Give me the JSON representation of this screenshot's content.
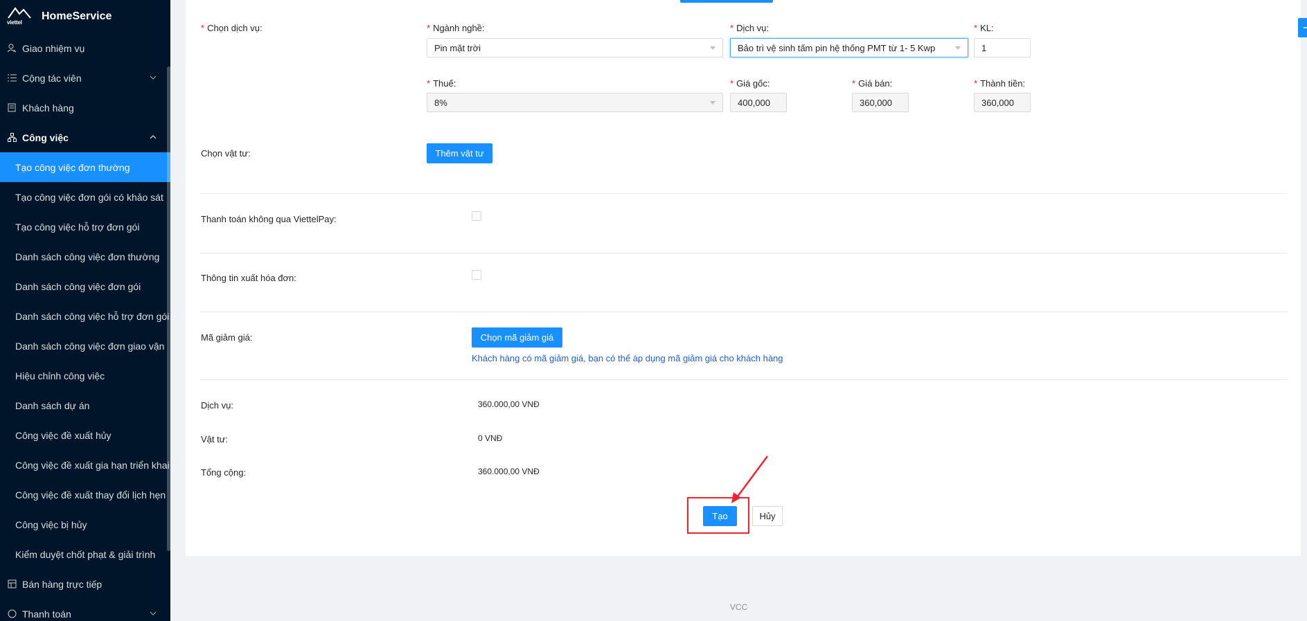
{
  "app": {
    "title": "HomeService",
    "logo_text": "viettel"
  },
  "sidebar": {
    "items": [
      {
        "label": "Giao nhiệm vụ"
      },
      {
        "label": "Cộng tác viên"
      },
      {
        "label": "Khách hàng"
      },
      {
        "label": "Công việc"
      }
    ],
    "sub_items": [
      {
        "label": "Tạo công việc đơn thường"
      },
      {
        "label": "Tạo công việc đơn gói có khảo sát"
      },
      {
        "label": "Tạo công việc hỗ trợ đơn gói"
      },
      {
        "label": "Danh sách công việc đơn thường"
      },
      {
        "label": "Danh sách công việc đơn gói"
      },
      {
        "label": "Danh sách công việc hỗ trợ đơn gói"
      },
      {
        "label": "Danh sách công việc đơn giao vận"
      },
      {
        "label": "Hiệu chỉnh công việc"
      },
      {
        "label": "Danh sách dự án"
      },
      {
        "label": "Công việc đề xuất hủy"
      },
      {
        "label": "Công việc đề xuất gia hạn triển khai"
      },
      {
        "label": "Công việc đề xuất thay đổi lịch hẹn"
      },
      {
        "label": "Công việc bị hủy"
      },
      {
        "label": "Kiểm duyệt chốt phạt & giải trình"
      }
    ],
    "bottom_items": [
      {
        "label": "Bán hàng trực tiếp"
      },
      {
        "label": "Thanh toán"
      }
    ]
  },
  "form": {
    "service_section_label": "Chọn dịch vụ:",
    "nganh_nghe": {
      "label": "Ngành nghề:",
      "value": "Pin mặt trời"
    },
    "dich_vu": {
      "label": "Dịch vụ:",
      "value": "Bảo trì vệ sinh tấm pin hệ thống PMT từ 1- 5 Kwp"
    },
    "kl": {
      "label": "KL:",
      "value": "1"
    },
    "thue": {
      "label": "Thuế:",
      "value": "8%"
    },
    "gia_goc": {
      "label": "Giá gốc:",
      "value": "400,000"
    },
    "gia_ban": {
      "label": "Giá bán:",
      "value": "360,000"
    },
    "thanh_tien": {
      "label": "Thành tiền:",
      "value": "360,000"
    },
    "vat_tu_label": "Chọn vật tư:",
    "them_vat_tu": "Thêm vật tư",
    "thanh_toan_label": "Thanh toán không qua ViettelPay:",
    "xuat_hoa_don_label": "Thông tin xuất hóa đơn:",
    "ma_giam_gia_label": "Mã giảm giá:",
    "chon_ma_giam_gia": "Chọn mã giảm giá",
    "discount_hint": "Khách hàng có mã giảm giá, bạn có thể áp dụng mã giảm giá cho khách hàng"
  },
  "summary": {
    "dich_vu_label": "Dịch vụ:",
    "dich_vu_value": "360.000,00 VNĐ",
    "vat_tu_label": "Vật tư:",
    "vat_tu_value": "0 VNĐ",
    "tong_cong_label": "Tổng cộng:",
    "tong_cong_value": "360.000,00 VNĐ"
  },
  "actions": {
    "create": "Tạo",
    "cancel": "Hủy"
  },
  "footer": {
    "text": "VCC"
  },
  "colors": {
    "primary": "#1890ff",
    "sidebar_bg": "#001529",
    "annotation": "#f5222d"
  }
}
